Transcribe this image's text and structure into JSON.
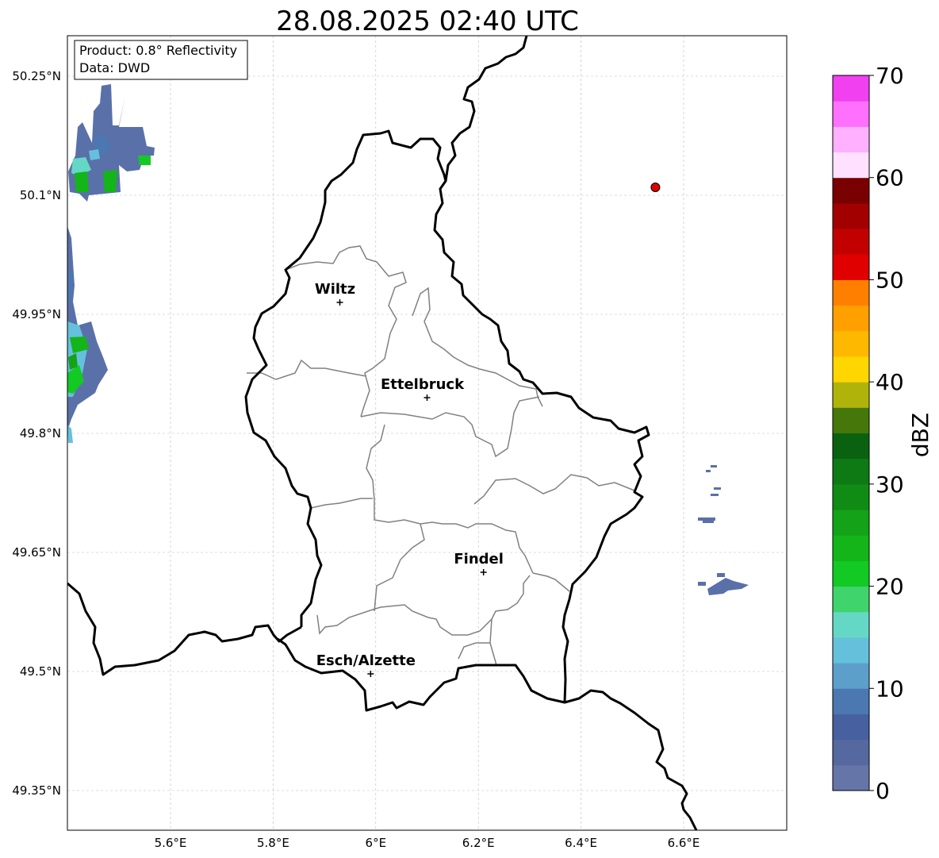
{
  "title": "28.08.2025 02:40 UTC",
  "info": {
    "product": "Product: 0.8° Reflectivity",
    "data": "Data: DWD"
  },
  "axes": {
    "x_ticks": [
      "5.6°E",
      "5.8°E",
      "6°E",
      "6.2°E",
      "6.4°E",
      "6.6°E"
    ],
    "y_ticks": [
      "50.25°N",
      "50.1°N",
      "49.95°N",
      "49.8°N",
      "49.65°N",
      "49.5°N",
      "49.35°N"
    ]
  },
  "cities": [
    {
      "name": "Wiltz",
      "lon": 5.93,
      "lat": 49.965
    },
    {
      "name": "Ettelbruck",
      "lon": 6.1,
      "lat": 49.845
    },
    {
      "name": "Findel",
      "lon": 6.21,
      "lat": 49.625
    },
    {
      "name": "Esch/Alzette",
      "lon": 5.99,
      "lat": 49.497
    }
  ],
  "marker": {
    "lon": 6.545,
    "lat": 50.11,
    "color": "#e00000"
  },
  "colorbar": {
    "label": "dBZ",
    "ticks": [
      "70",
      "60",
      "50",
      "40",
      "30",
      "20",
      "10",
      "0"
    ],
    "colors": [
      "#6575a8",
      "#5668a0",
      "#47609f",
      "#4b78b0",
      "#5b9fca",
      "#65c0dc",
      "#65d8c5",
      "#40d46d",
      "#13c923",
      "#13b518",
      "#13a218",
      "#108b13",
      "#0d7a13",
      "#0a6210",
      "#45770a",
      "#b0b40a",
      "#ffd600",
      "#ffb800",
      "#ffa000",
      "#ff8000",
      "#e00000",
      "#c30000",
      "#a20000",
      "#780000",
      "#ffe0ff",
      "#ffb0ff",
      "#ff70ff",
      "#f040f0"
    ]
  },
  "colors": {
    "border": "#000000",
    "cantons": "#808080",
    "grid": "#bbbbbb"
  }
}
